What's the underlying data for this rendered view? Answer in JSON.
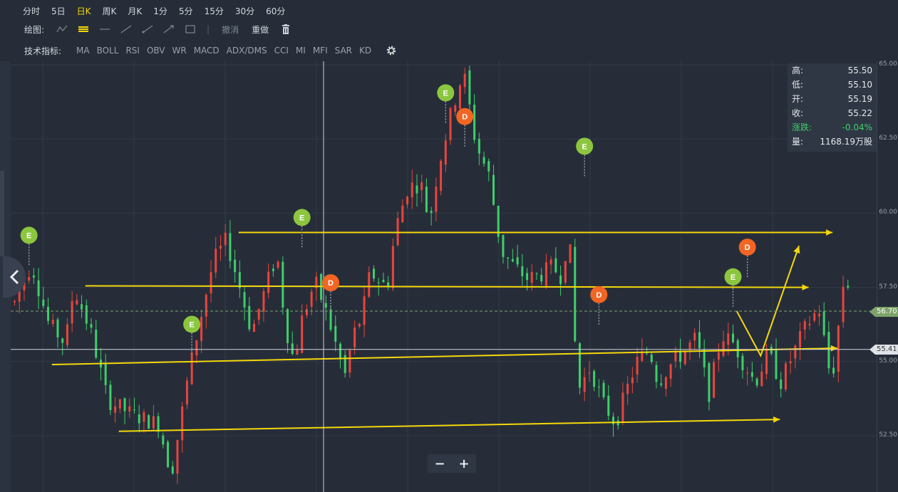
{
  "timeframes": [
    "分时",
    "5日",
    "日K",
    "周K",
    "月K",
    "1分",
    "5分",
    "15分",
    "30分",
    "60分"
  ],
  "active_timeframe": "日K",
  "drawing": {
    "label": "绘图:",
    "tools": [
      "trend-icon",
      "parallel-lines-icon",
      "horizontal-line-icon",
      "line-segment-icon",
      "ray-icon",
      "arrow-line-icon",
      "rectangle-icon"
    ],
    "undo": "撤消",
    "redo": "重做"
  },
  "indicators": {
    "label": "技术指标:",
    "items": [
      "MA",
      "BOLL",
      "RSI",
      "OBV",
      "WR",
      "MACD",
      "ADX/DMS",
      "CCI",
      "MI",
      "MFI",
      "SAR",
      "KD"
    ]
  },
  "info": {
    "high_label": "高:",
    "high": "55.50",
    "low_label": "低:",
    "low": "55.10",
    "open_label": "开:",
    "open": "55.19",
    "close_label": "收:",
    "close": "55.22",
    "change_label": "涨跌:",
    "change": "-0.04%",
    "volume_label": "量:",
    "volume": "1168.19万股"
  },
  "yaxis_ticks": [
    "65.00",
    "62.50",
    "60.00",
    "57.50",
    "55.00",
    "52.50"
  ],
  "current_price": "56.70",
  "crosshair_price": "55.41",
  "zoom": {
    "minus": "−",
    "plus": "+"
  },
  "colors": {
    "up": "#e8453c",
    "down": "#3ecf6a",
    "accent": "#f5d80a",
    "e_marker": "#8cc63f",
    "d_marker": "#f26522"
  },
  "chart_data": {
    "type": "candlestick",
    "ylim": [
      50.5,
      65.1
    ],
    "markers": [
      {
        "label": "E",
        "bar": 3,
        "price": 58.2
      },
      {
        "label": "E",
        "bar": 37,
        "price": 55.2
      },
      {
        "label": "E",
        "bar": 60,
        "price": 58.8
      },
      {
        "label": "D",
        "bar": 66,
        "price": 56.6
      },
      {
        "label": "E",
        "bar": 90,
        "price": 63.0
      },
      {
        "label": "D",
        "bar": 94,
        "price": 62.2
      },
      {
        "label": "E",
        "bar": 119,
        "price": 61.2
      },
      {
        "label": "D",
        "bar": 122,
        "price": 56.2
      },
      {
        "label": "E",
        "bar": 150,
        "price": 56.8
      },
      {
        "label": "D",
        "bar": 153,
        "price": 57.8
      }
    ],
    "trendlines": [
      {
        "from": [
          47,
          59.35
        ],
        "to": [
          171,
          59.35
        ]
      },
      {
        "from": [
          15,
          57.55
        ],
        "to": [
          166,
          57.5
        ]
      },
      {
        "from": [
          8,
          54.9
        ],
        "to": [
          172,
          55.45
        ]
      },
      {
        "from": [
          22,
          52.65
        ],
        "to": [
          160,
          53.05
        ]
      }
    ],
    "projection": [
      [
        151,
        56.7
      ],
      [
        156,
        55.2
      ],
      [
        164,
        58.9
      ]
    ]
  }
}
